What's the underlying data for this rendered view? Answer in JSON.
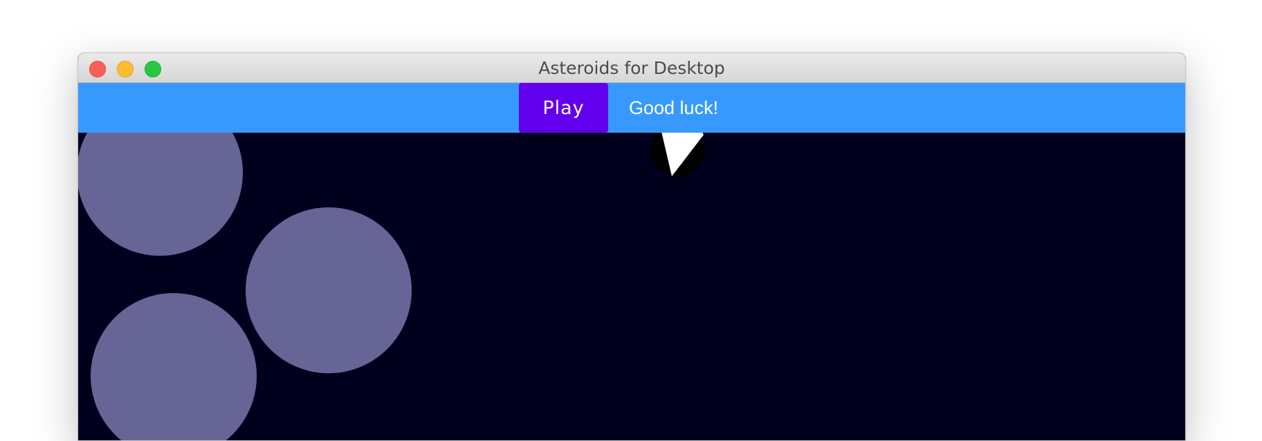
{
  "window": {
    "title": "Asteroids for Desktop"
  },
  "toolbar": {
    "play_label": "Play",
    "status_text": "Good luck!"
  },
  "colors": {
    "toolbar_bg": "#3799fe",
    "play_button_bg": "#6200ee",
    "game_bg": "#00001e",
    "asteroid": "#666596",
    "ship": "#ffffff",
    "ship_shield": "#000000"
  },
  "icons": {
    "close": "close-icon",
    "minimize": "minimize-icon",
    "maximize": "maximize-icon"
  }
}
